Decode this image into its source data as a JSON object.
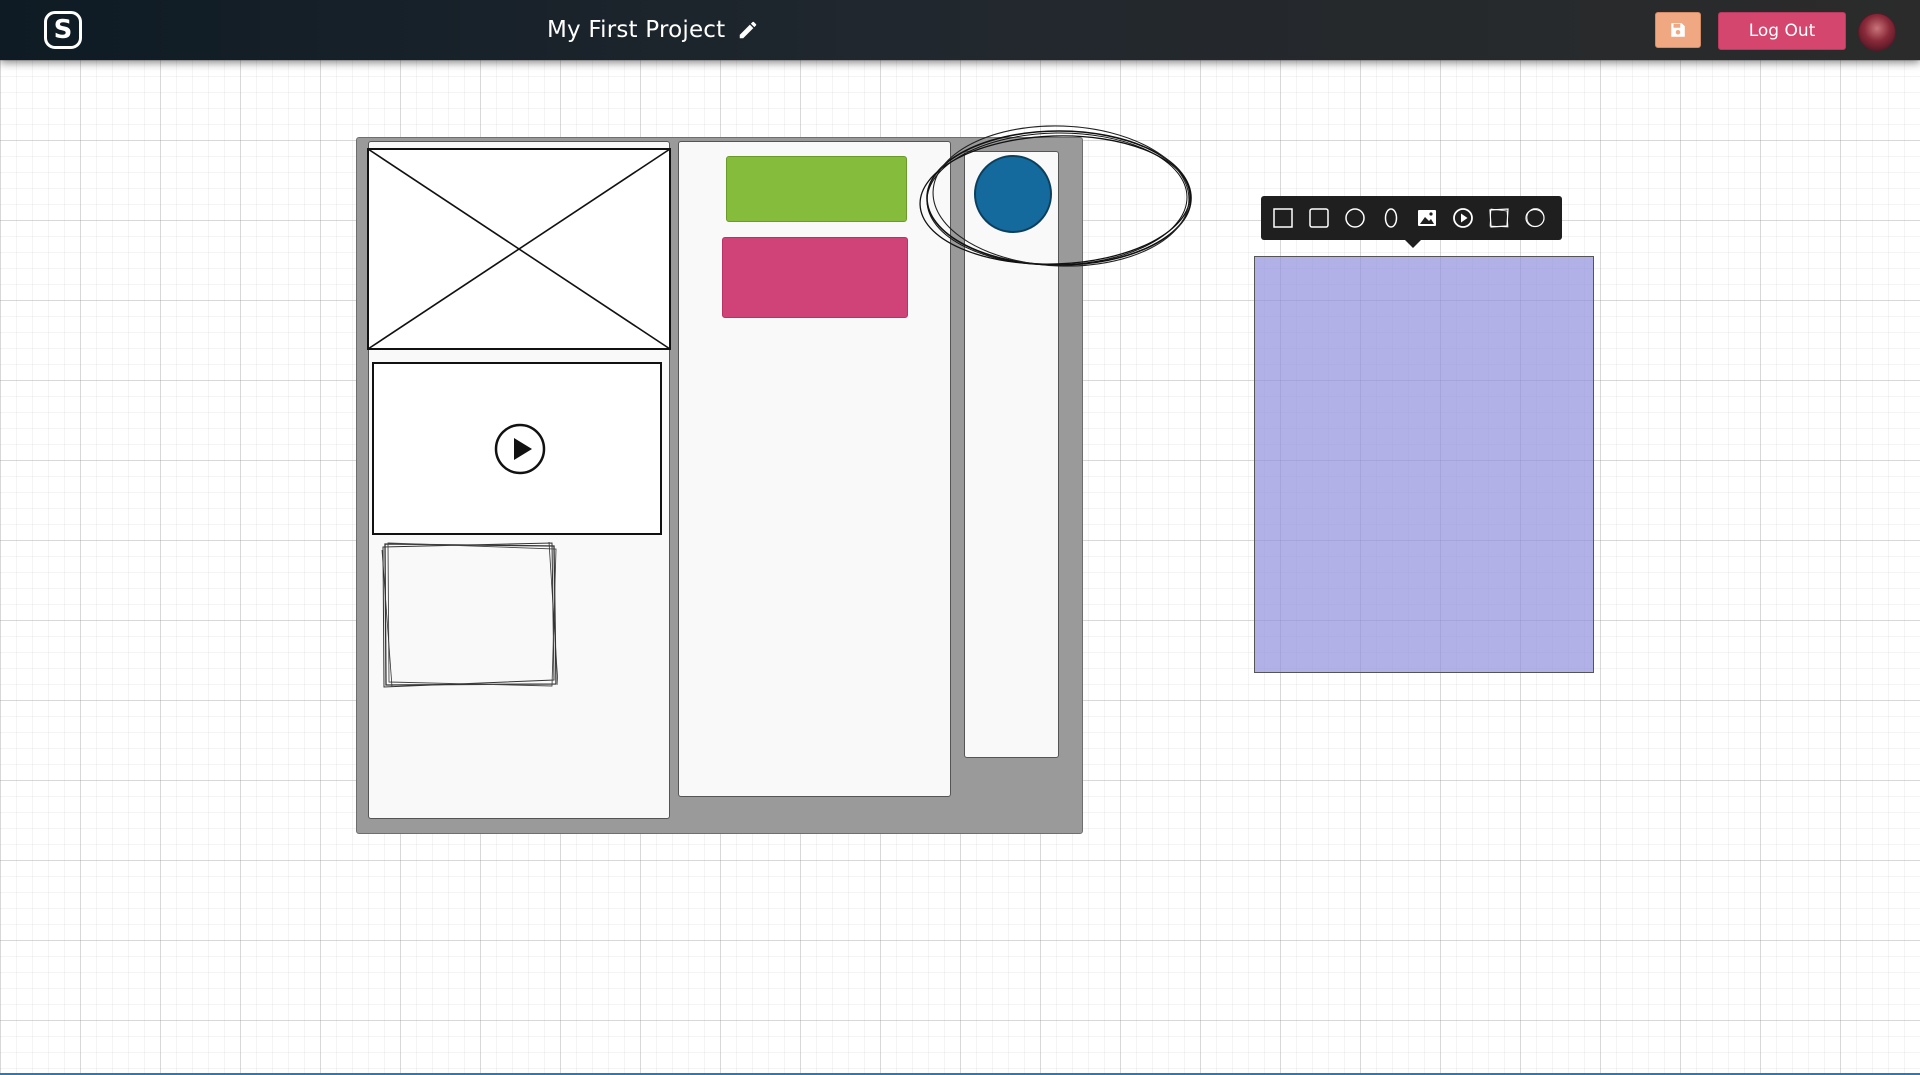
{
  "header": {
    "logo_letter": "S",
    "project_title": "My First Project",
    "logout_label": "Log Out"
  },
  "colors": {
    "green_button": "#86bc3c",
    "pink_button": "#cf4378",
    "blue_circle": "#146a9c",
    "purple_rect": "#8c8cdc",
    "logout": "#d4466e",
    "save": "#f0a882"
  },
  "toolbar": {
    "tools": [
      {
        "icon": "square-outline-icon"
      },
      {
        "icon": "rounded-square-icon"
      },
      {
        "icon": "circle-outline-icon"
      },
      {
        "icon": "ellipse-outline-icon"
      },
      {
        "icon": "image-icon"
      },
      {
        "icon": "play-circle-icon"
      },
      {
        "icon": "sketch-square-icon"
      },
      {
        "icon": "sketch-circle-icon"
      }
    ]
  }
}
